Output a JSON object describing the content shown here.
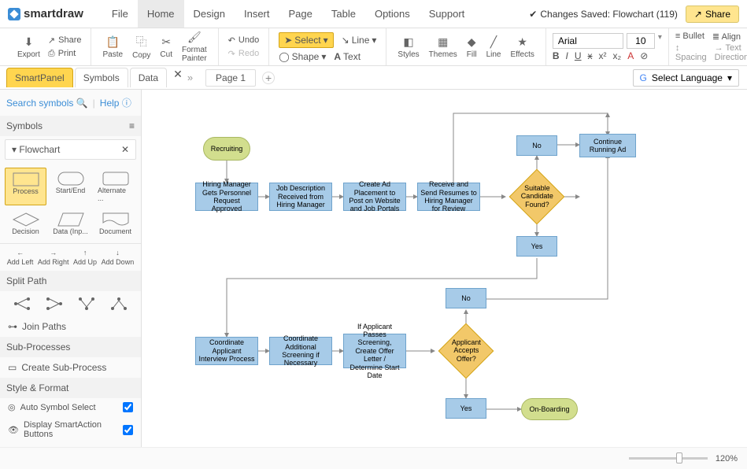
{
  "app": {
    "name": "smartdraw"
  },
  "menus": [
    "File",
    "Home",
    "Design",
    "Insert",
    "Page",
    "Table",
    "Options",
    "Support"
  ],
  "active_menu": "Home",
  "save_status": "Changes Saved: Flowchart (119)",
  "share_label": "Share",
  "ribbon": {
    "export": "Export",
    "share": "Share",
    "print": "Print",
    "paste": "Paste",
    "copy": "Copy",
    "cut": "Cut",
    "format_painter": "Format Painter",
    "undo": "Undo",
    "redo": "Redo",
    "select": "Select",
    "line": "Line",
    "shape": "Shape",
    "text": "Text",
    "styles": "Styles",
    "themes": "Themes",
    "fill": "Fill",
    "line2": "Line",
    "effects": "Effects",
    "font": "Arial",
    "size": "10",
    "bullet": "Bullet",
    "align": "Align",
    "spacing": "Spacing",
    "text_dir": "Text Direction"
  },
  "panel_tabs": [
    "SmartPanel",
    "Symbols",
    "Data"
  ],
  "page_label": "Page 1",
  "lang_label": "Select Language",
  "sidebar": {
    "search": "Search symbols",
    "help": "Help",
    "symbols_hdr": "Symbols",
    "flowchart_hdr": "Flowchart",
    "shapes": [
      "Process",
      "Start/End",
      "Alternate ...",
      "Decision",
      "Data (Inp...",
      "Document"
    ],
    "dirs": [
      "Add Left",
      "Add Right",
      "Add Up",
      "Add Down"
    ],
    "split_hdr": "Split Path",
    "join": "Join Paths",
    "sub_hdr": "Sub-Processes",
    "create_sub": "Create Sub-Process",
    "style_hdr": "Style & Format",
    "auto_sel": "Auto Symbol Select",
    "smart_action": "Display SmartAction Buttons"
  },
  "flowchart": {
    "n1": "Recruiting",
    "n2": "Hiring Manager Gets Personnel Request Approved",
    "n3": "Job Description Received from Hiring Manager",
    "n4": "Create Ad Placement to Post on Website and Job Portals",
    "n5": "Receive and Send Resumes to Hiring Manager for Review",
    "n6": "Suitable Candidate Found?",
    "n7": "No",
    "n8": "Continue Running Ad",
    "n9": "Yes",
    "n10": "Coordinate Applicant Interview Process",
    "n11": "Coordinate Additional Screening if Necessary",
    "n12": "If Applicant Passes Screening, Create Offer Letter / Determine Start Date",
    "n13": "Applicant Accepts Offer?",
    "n14": "No",
    "n15": "Yes",
    "n16": "On-Boarding"
  },
  "zoom": "120%"
}
